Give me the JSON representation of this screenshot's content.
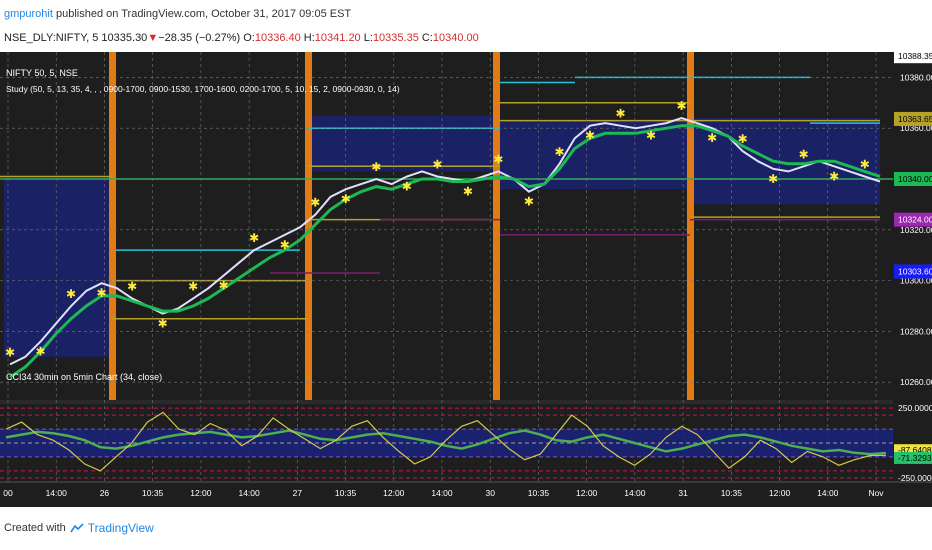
{
  "header": {
    "user": "gmpurohit",
    "published_text": "published on TradingView.com, October 31, 2017 09:05 EST",
    "symbol": "NSE_DLY:NIFTY, 5",
    "last": "10335.30",
    "down_arrow": "▼",
    "change": "−28.35 (−0.27%)",
    "o_label": "O:",
    "o_value": "10336.40",
    "h_label": "H:",
    "h_value": "10341.20",
    "l_label": "L:",
    "l_value": "10335.35",
    "c_label": "C:",
    "c_value": "10340.00"
  },
  "footer": {
    "created_with": "Created with",
    "brand": "TradingView",
    "logo_icon": "tradingview-logo-icon"
  },
  "colors": {
    "background": "#1e1e1e",
    "blue_zone": "#1a237e",
    "orange": "#e07b16",
    "green": "#1db954",
    "lime": "#4caf50",
    "yellow": "#ffeb3b",
    "cyan": "#26c6da",
    "olive": "#b6a229",
    "white_line": "#e0e0ff",
    "purple": "#7b1f6e"
  },
  "chart_data": [
    {
      "type": "line",
      "title": "NIFTY 50, 5, NSE",
      "subtitle": "Study (50, 5, 13, 35, 4, , , 0900-1700, 0900-1530, 1700-1600, 0200-1700, 5, 10, 15, 2, 0900-0930, 0, 14)",
      "ylim": [
        10253,
        10390
      ],
      "y_ticks": [
        10260,
        10280,
        10300,
        10320,
        10340,
        10360,
        10380
      ],
      "y_tick_labels": [
        "10260.00",
        "10280.00",
        "10300.00",
        "10320.00",
        "10340.00",
        "10360.00",
        "10380.00"
      ],
      "price_tags": [
        {
          "label": "10388.35",
          "value": 10388.35,
          "color": "#ffffff",
          "text_color": "#000000"
        },
        {
          "label": "10363.65",
          "value": 10363.65,
          "color": "#b6a229",
          "text_color": "#000000"
        },
        {
          "label": "10340.00",
          "value": 10340.0,
          "color": "#1db954",
          "text_color": "#000000"
        },
        {
          "label": "10324.00",
          "value": 10324.0,
          "color": "#9c27b0",
          "text_color": "#ffffff"
        },
        {
          "label": "10303.60",
          "value": 10303.6,
          "color": "#1a1aff",
          "text_color": "#ffffff"
        }
      ],
      "x_ticks": [
        "00",
        "14:00",
        "26",
        "10:35",
        "12:00",
        "14:00",
        "27",
        "10:35",
        "12:00",
        "14:00",
        "30",
        "10:35",
        "12:00",
        "14:00",
        "31",
        "10:35",
        "12:00",
        "14:00",
        "Nov"
      ],
      "series": [
        {
          "color": "#ffffff",
          "values": [
            10267,
            10270,
            10276,
            10283,
            10290,
            10296,
            10299,
            10297,
            10293,
            10290,
            10287,
            10289,
            10293,
            10297,
            10302,
            10307,
            10312,
            10315,
            10318,
            10321,
            10326,
            10333,
            10336,
            10338,
            10340,
            10338,
            10341,
            10343,
            10341,
            10340,
            10339,
            10341,
            10343,
            10340,
            10335,
            10338,
            10346,
            10356,
            10361,
            10362,
            10361,
            10360,
            10361,
            10362,
            10364,
            10362,
            10360,
            10357,
            10351,
            10347,
            10344,
            10343,
            10345,
            10347,
            10345,
            10343,
            10341,
            10339
          ]
        },
        {
          "color": "#1db954",
          "values": [
            10262,
            10266,
            10272,
            10279,
            10285,
            10290,
            10294,
            10294,
            10292,
            10290,
            10288,
            10288,
            10290,
            10293,
            10297,
            10301,
            10305,
            10309,
            10312,
            10316,
            10322,
            10328,
            10332,
            10335,
            10337,
            10336,
            10338,
            10340,
            10340,
            10339,
            10339,
            10340,
            10341,
            10340,
            10337,
            10338,
            10344,
            10352,
            10356,
            10358,
            10358,
            10358,
            10359,
            10360,
            10361,
            10361,
            10359,
            10357,
            10353,
            10350,
            10347,
            10346,
            10346,
            10347,
            10347,
            10345,
            10343,
            10341
          ]
        }
      ]
    },
    {
      "type": "line",
      "title": "CCI34 30min on 5min Chart (34, close)",
      "ylim": [
        -280,
        280
      ],
      "y_tick_labels": [
        "250.0000",
        "-87.6408",
        "-71.3293",
        "-250.0000"
      ],
      "value_tags": [
        {
          "label": "-87.6408",
          "value": -87.6408,
          "color": "#f0e442",
          "text_color": "#000000"
        },
        {
          "label": "-71.3293",
          "value": -71.3293,
          "color": "#26c26b",
          "text_color": "#000000"
        }
      ],
      "levels": [
        250,
        200,
        100,
        0,
        -100,
        -200,
        -250
      ],
      "series": [
        {
          "color": "#4caf50",
          "values": [
            40,
            60,
            80,
            70,
            50,
            20,
            -30,
            -40,
            -20,
            10,
            40,
            60,
            70,
            80,
            60,
            40,
            50,
            70,
            90,
            60,
            30,
            20,
            40,
            60,
            70,
            50,
            30,
            10,
            -20,
            -40,
            -10,
            30,
            70,
            90,
            60,
            20,
            10,
            40,
            60,
            30,
            0,
            -30,
            -60,
            -40,
            -10,
            20,
            50,
            60,
            40,
            10,
            -20,
            -40,
            -60,
            -50,
            -70,
            -80,
            -72
          ]
        },
        {
          "color": "#d4c94a",
          "values": [
            100,
            150,
            60,
            20,
            -50,
            -150,
            -200,
            -100,
            0,
            150,
            220,
            100,
            60,
            140,
            90,
            -20,
            50,
            180,
            100,
            30,
            -40,
            20,
            120,
            160,
            40,
            -60,
            -150,
            -100,
            20,
            120,
            160,
            60,
            -40,
            -120,
            -80,
            60,
            200,
            120,
            -20,
            -100,
            -160,
            -80,
            40,
            120,
            60,
            -60,
            -180,
            -100,
            20,
            -40,
            -140,
            -60,
            -100,
            -160,
            -120,
            -90,
            -88
          ]
        }
      ]
    }
  ]
}
